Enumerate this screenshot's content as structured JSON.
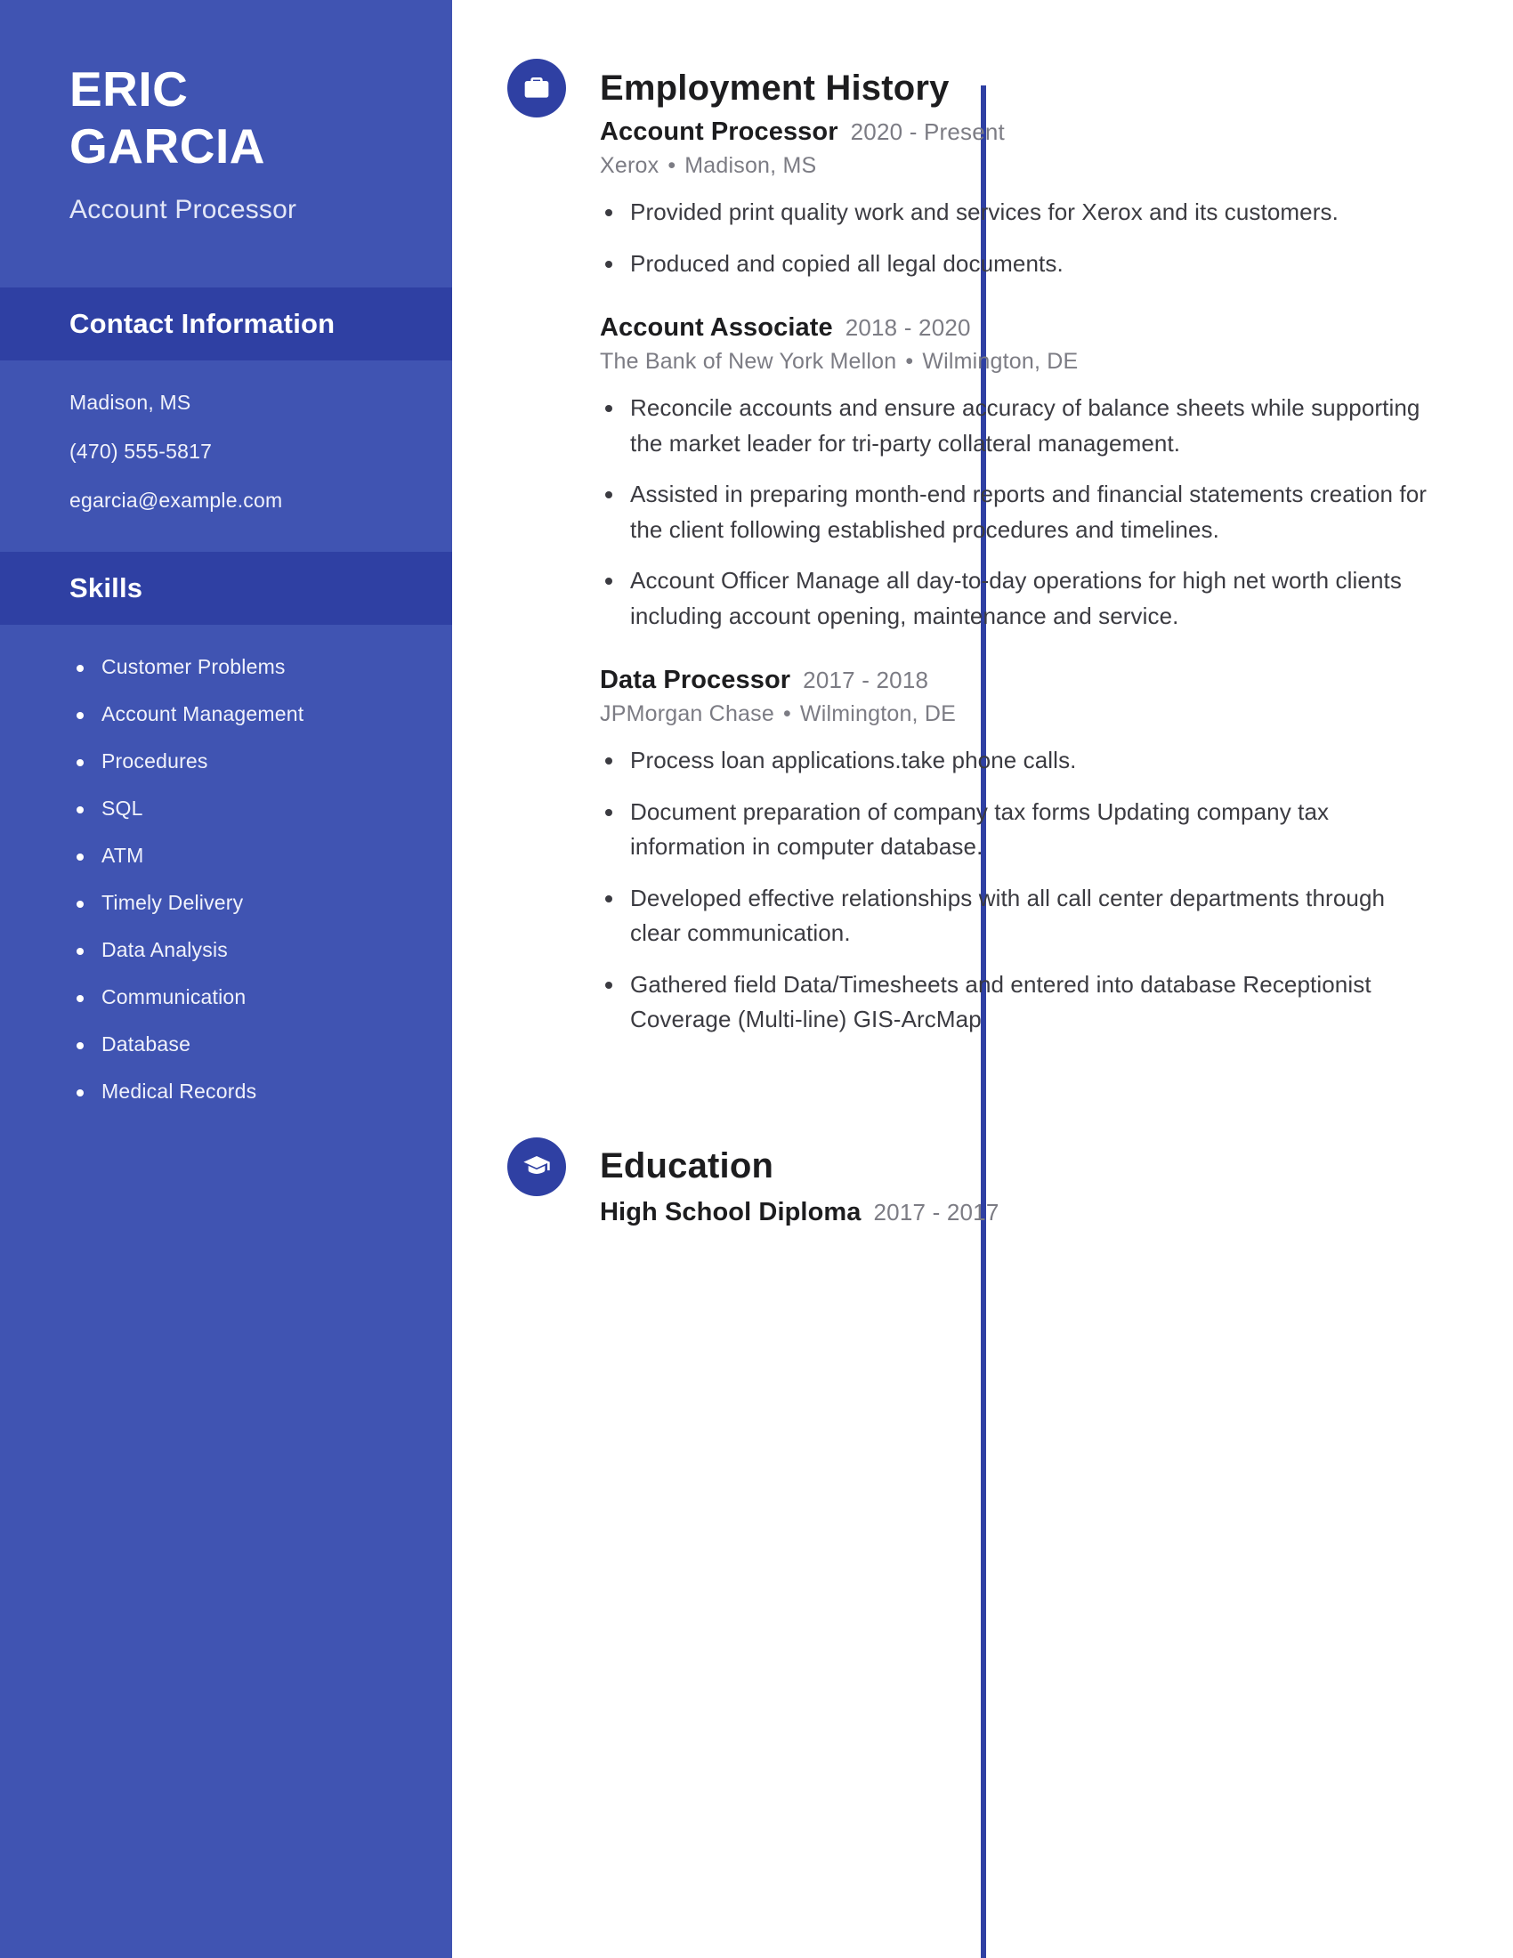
{
  "theme": {
    "sidebar_bg": "#4054B2",
    "sidebar_header_bg": "#2F40A3",
    "accent": "#2F40A3",
    "body_text": "#3B3B41",
    "muted_text": "#7C7C84"
  },
  "sidebar": {
    "first_name": "ERIC",
    "last_name": "GARCIA",
    "job_title": "Account Processor",
    "contact": {
      "heading": "Contact Information",
      "lines": [
        "Madison, MS",
        "(470) 555-5817",
        "egarcia@example.com"
      ]
    },
    "skills": {
      "heading": "Skills",
      "items": [
        "Customer Problems",
        "Account Management",
        "Procedures",
        "SQL",
        "ATM",
        "Timely Delivery",
        "Data Analysis",
        "Communication",
        "Database",
        "Medical Records"
      ]
    }
  },
  "main": {
    "employment": {
      "heading": "Employment History",
      "icon": "briefcase-icon",
      "entries": [
        {
          "title": "Account Processor",
          "dates": "2020 - Present",
          "company": "Xerox",
          "location": "Madison, MS",
          "bullets": [
            "Provided print quality work and services for Xerox and its customers.",
            "Produced and copied all legal documents."
          ]
        },
        {
          "title": "Account Associate",
          "dates": "2018 - 2020",
          "company": "The Bank of New York Mellon",
          "location": "Wilmington, DE",
          "bullets": [
            "Reconcile accounts and ensure accuracy of balance sheets while supporting the market leader for tri-party collateral management.",
            "Assisted in preparing month-end reports and financial statements creation for the client following established procedures and timelines.",
            "Account Officer Manage all day-to-day operations for high net worth clients including account opening, maintenance and service."
          ]
        },
        {
          "title": "Data Processor",
          "dates": "2017 - 2018",
          "company": "JPMorgan Chase",
          "location": "Wilmington, DE",
          "bullets": [
            "Process loan applications.take phone calls.",
            "Document preparation of company tax forms Updating company tax information in computer database.",
            "Developed effective relationships with all call center departments through clear communication.",
            "Gathered field Data/Timesheets and entered into database Receptionist Coverage (Multi-line) GIS-ArcMap"
          ]
        }
      ]
    },
    "education": {
      "heading": "Education",
      "icon": "graduation-cap-icon",
      "entries": [
        {
          "title": "High School Diploma",
          "dates": "2017 - 2017"
        }
      ]
    }
  },
  "separator": "•"
}
